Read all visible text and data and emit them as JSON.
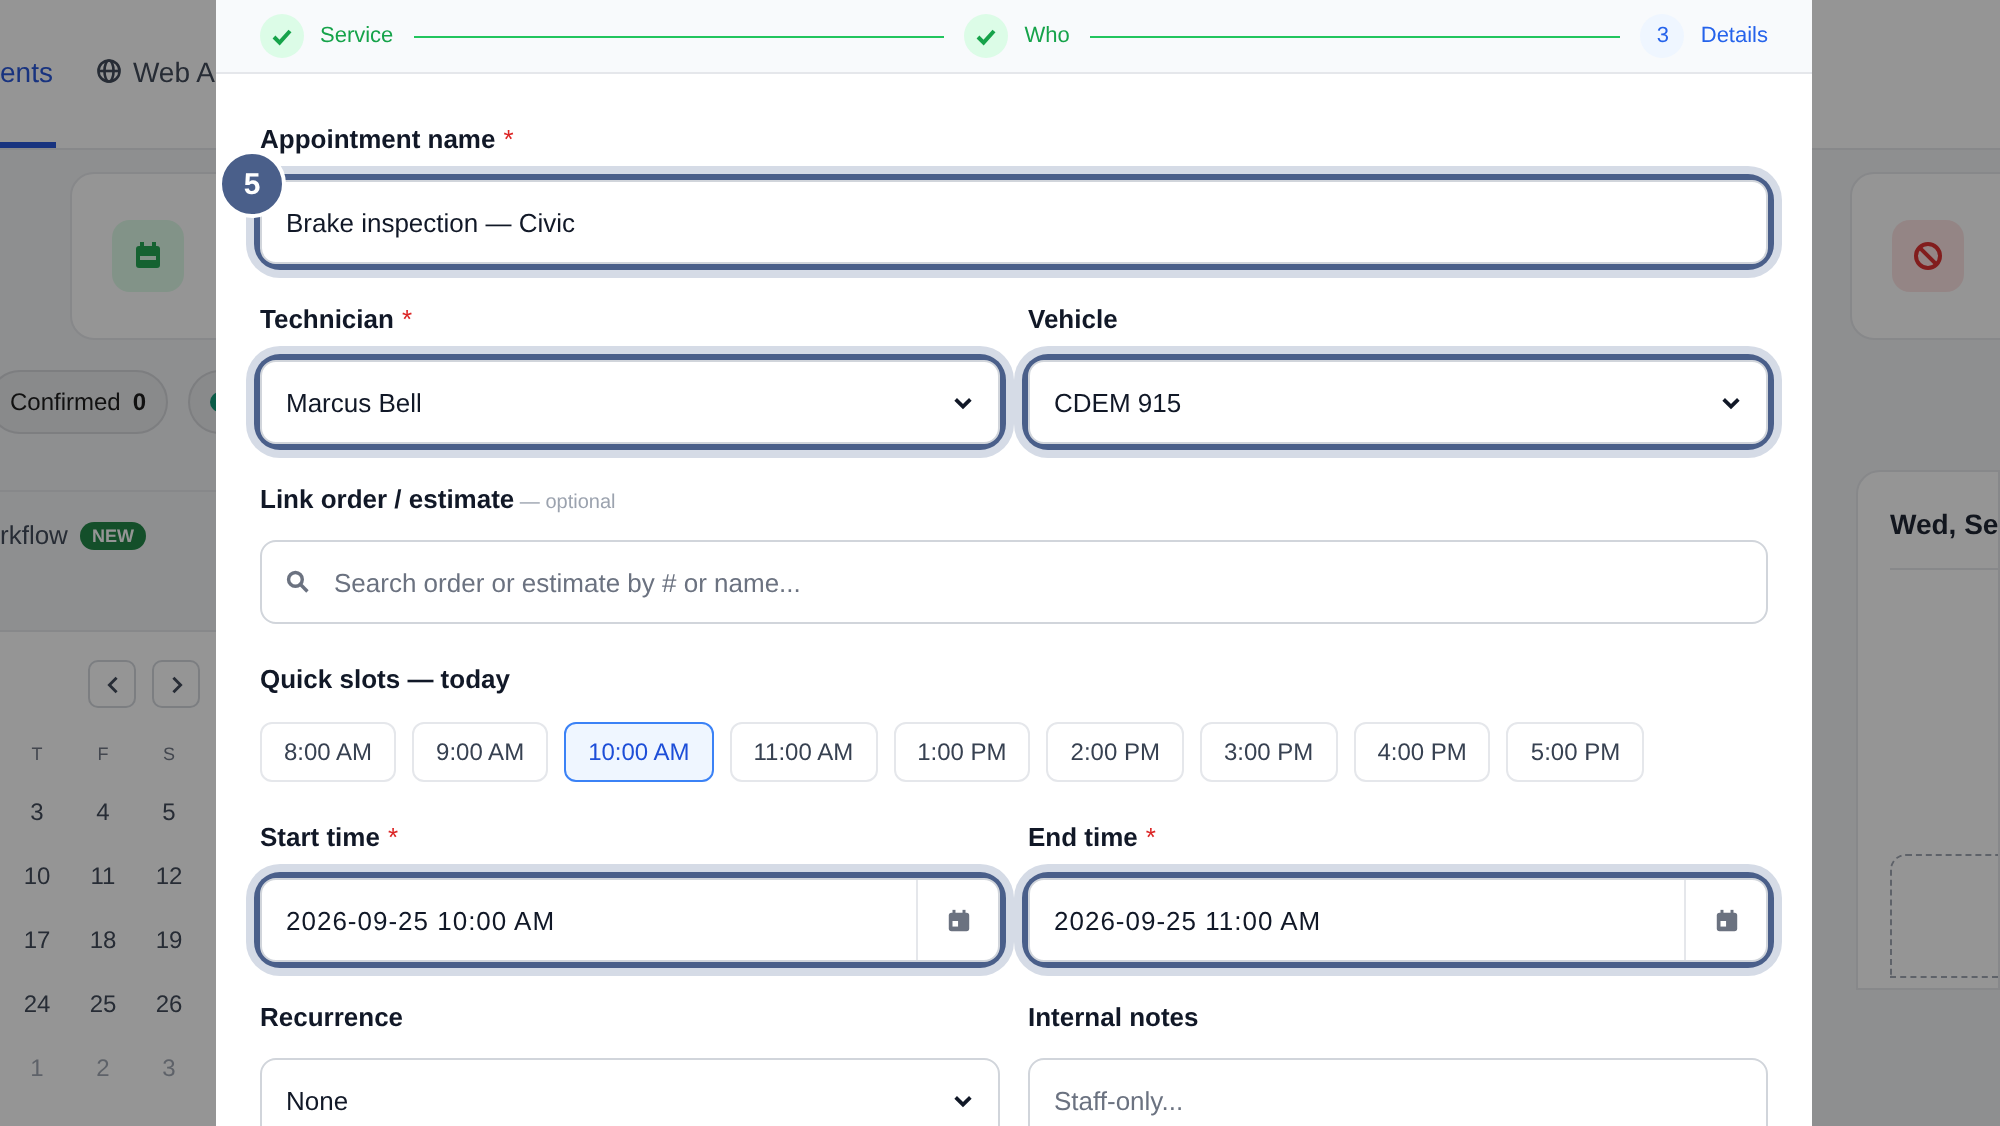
{
  "background": {
    "tabs": [
      {
        "label": "ents",
        "selected": true
      },
      {
        "label": "Web A",
        "selected": false
      }
    ],
    "chips": [
      {
        "label": "Confirmed",
        "count": "0"
      },
      {
        "color": "#0b5c48"
      }
    ],
    "workflow": {
      "label": "rkflow",
      "badge": "NEW"
    },
    "calendar": {
      "weekdays": [
        "T",
        "F",
        "S"
      ],
      "weeks": [
        [
          "3",
          "4",
          "5"
        ],
        [
          "10",
          "11",
          "12"
        ],
        [
          "17",
          "18",
          "19"
        ],
        [
          "24",
          "25",
          "26"
        ],
        [
          "1",
          "2",
          "3"
        ]
      ]
    },
    "day_heading": "Wed, Se"
  },
  "modal": {
    "steps": [
      {
        "label": "Service",
        "done": true
      },
      {
        "label": "Who",
        "done": true
      },
      {
        "label": "Details",
        "number": "3",
        "done": false
      }
    ],
    "marker": "5",
    "rows": [
      {
        "kind": "fields",
        "fields": [
          {
            "kind": "text",
            "label": "Appointment name",
            "required_mark": "*",
            "value": "Brake inspection — Civic",
            "highlighted": true
          }
        ]
      },
      {
        "kind": "fields",
        "fields": [
          {
            "kind": "select",
            "label": "Technician",
            "required_mark": "*",
            "value": "Marcus Bell",
            "highlighted": true
          },
          {
            "kind": "select",
            "label": "Vehicle",
            "value": "CDEM 915",
            "highlighted": true
          }
        ]
      },
      {
        "kind": "fields",
        "fields": [
          {
            "kind": "search",
            "label": "Link order / estimate",
            "hint": "— optional",
            "placeholder": "Search order or estimate by # or name...",
            "highlighted": false
          }
        ]
      },
      {
        "kind": "slots",
        "label": "Quick slots — today",
        "slots": [
          {
            "label": "8:00 AM",
            "selected": false
          },
          {
            "label": "9:00 AM",
            "selected": false
          },
          {
            "label": "10:00 AM",
            "selected": true
          },
          {
            "label": "11:00 AM",
            "selected": false
          },
          {
            "label": "1:00 PM",
            "selected": false
          },
          {
            "label": "2:00 PM",
            "selected": false
          },
          {
            "label": "3:00 PM",
            "selected": false
          },
          {
            "label": "4:00 PM",
            "selected": false
          },
          {
            "label": "5:00 PM",
            "selected": false
          }
        ]
      },
      {
        "kind": "fields",
        "fields": [
          {
            "kind": "datetime",
            "label": "Start time",
            "required_mark": "*",
            "value": "2026-09-25 10:00 AM",
            "highlighted": true
          },
          {
            "kind": "datetime",
            "label": "End time",
            "required_mark": "*",
            "value": "2026-09-25 11:00 AM",
            "highlighted": true
          }
        ]
      },
      {
        "kind": "fields",
        "fields": [
          {
            "kind": "select",
            "label": "Recurrence",
            "value": "None",
            "highlighted": false
          },
          {
            "kind": "textarea",
            "label": "Internal notes",
            "placeholder": "Staff-only...",
            "highlighted": false
          }
        ]
      }
    ]
  }
}
